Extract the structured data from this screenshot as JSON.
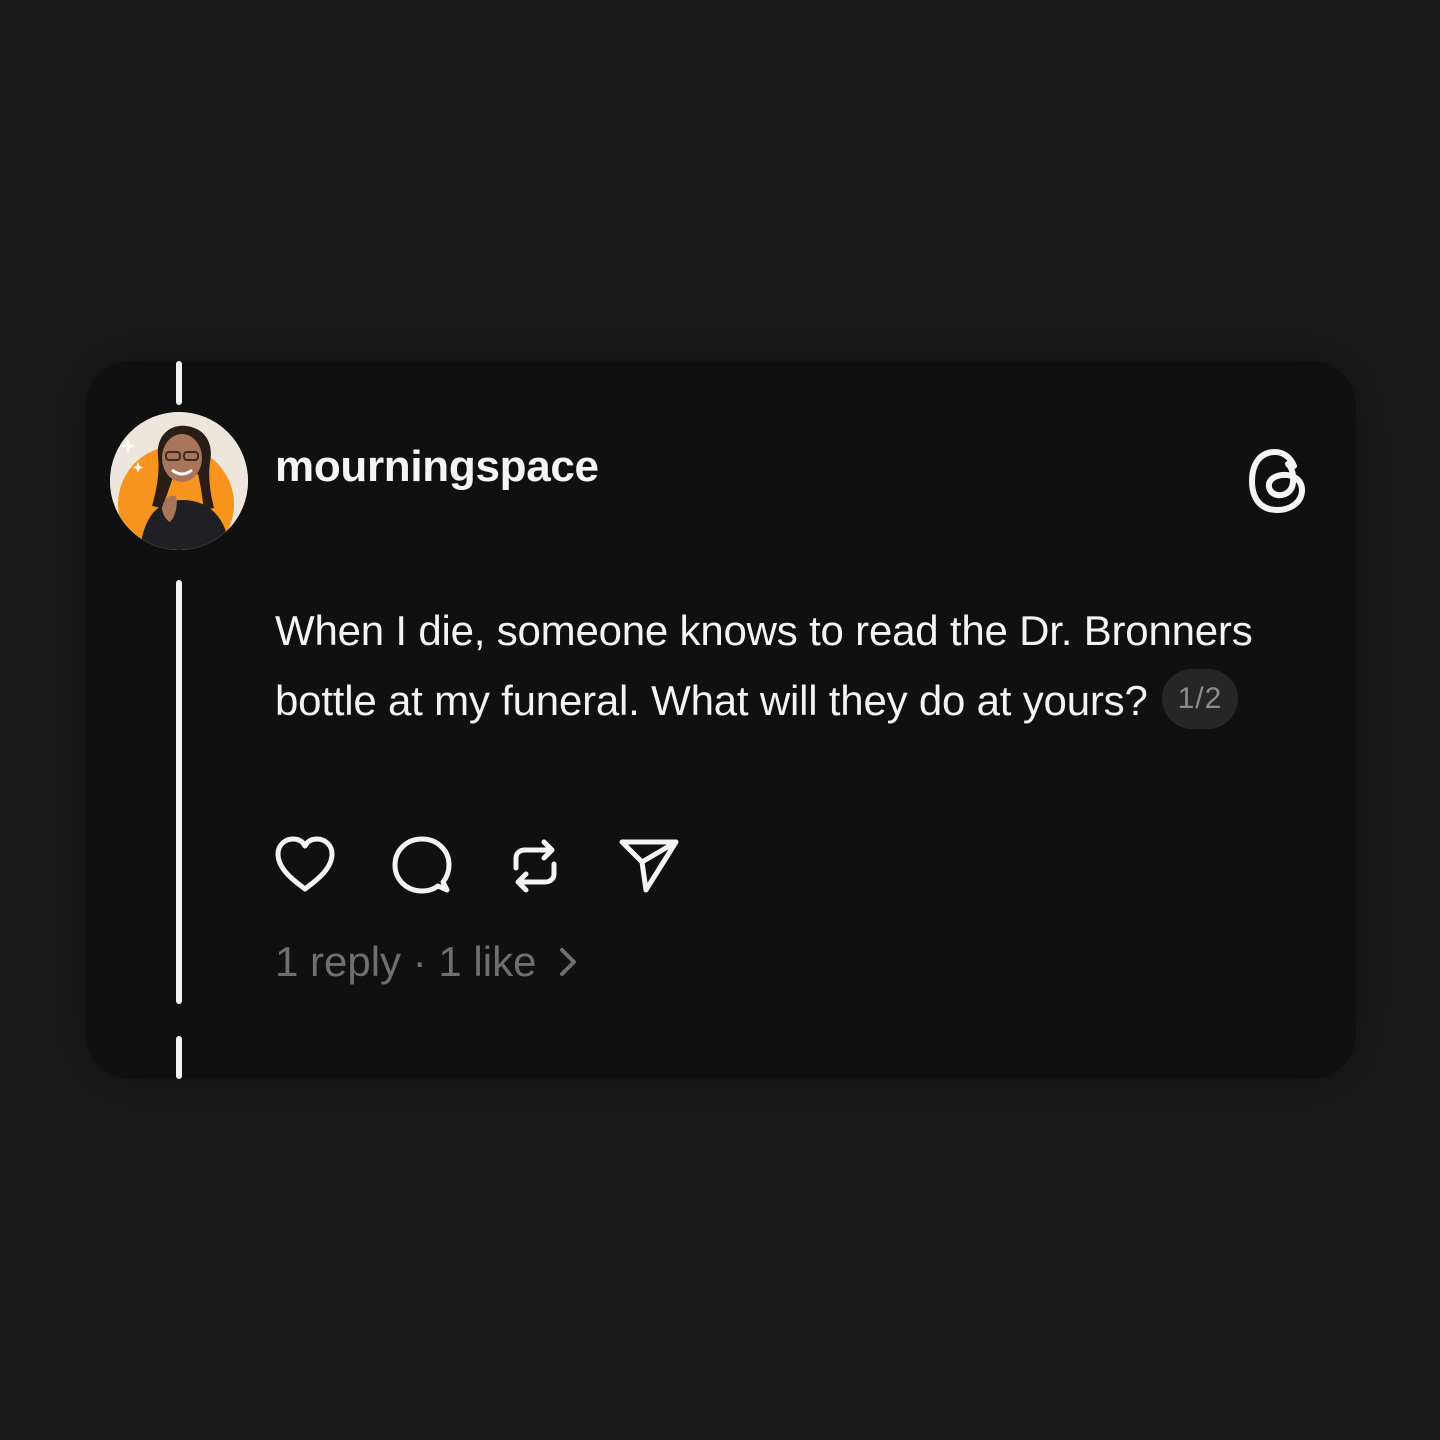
{
  "post": {
    "username": "mourningspace",
    "text": "When I die, someone knows to read the Dr. Bronners bottle at my funeral. What will they do at yours?",
    "thread_indicator": "1/2",
    "stats": "1 reply · 1 like"
  },
  "icons": {
    "logo": "threads-logo-icon",
    "actions": [
      "heart-icon",
      "comment-icon",
      "repost-icon",
      "share-icon"
    ],
    "stats_chevron": "chevron-right-icon"
  },
  "colors": {
    "background": "#1a1a1a",
    "card": "#101010",
    "text": "#f3f3f3",
    "muted": "#6f6f6f",
    "avatar_accent": "#f7941d"
  }
}
